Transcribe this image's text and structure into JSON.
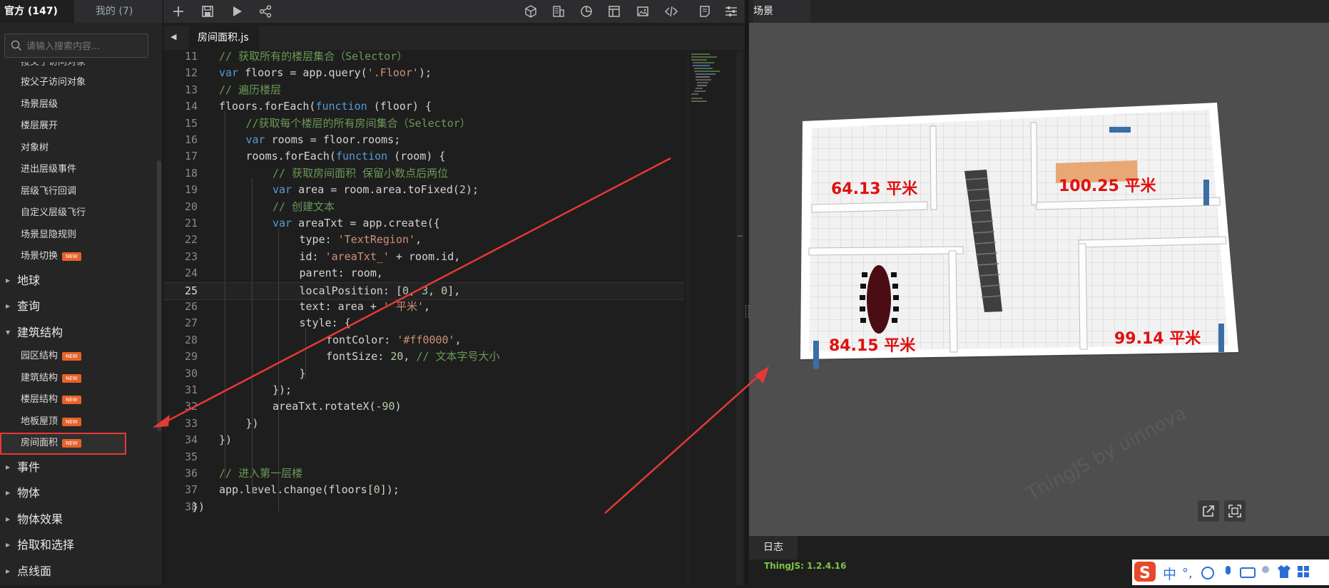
{
  "sidebar": {
    "tabs": [
      {
        "label": "官方 (147)"
      },
      {
        "label": "我的 (7)"
      }
    ],
    "search_placeholder": "请输入搜索内容...",
    "cut_item": "按父子访问对象",
    "items": [
      {
        "label": "按父子访问对象",
        "new": false
      },
      {
        "label": "场景层级",
        "new": false
      },
      {
        "label": "楼层展开",
        "new": false
      },
      {
        "label": "对象树",
        "new": false
      },
      {
        "label": "进出层级事件",
        "new": false
      },
      {
        "label": "层级飞行回调",
        "new": false
      },
      {
        "label": "自定义层级飞行",
        "new": false
      },
      {
        "label": "场景显隐规则",
        "new": false
      },
      {
        "label": "场景切换",
        "new": true
      }
    ],
    "categories": [
      {
        "label": "地球"
      },
      {
        "label": "查询"
      },
      {
        "label": "建筑结构"
      }
    ],
    "sub_items": [
      {
        "label": "园区结构",
        "new": true
      },
      {
        "label": "建筑结构",
        "new": true
      },
      {
        "label": "楼层结构",
        "new": true
      },
      {
        "label": "地板屋顶",
        "new": true
      },
      {
        "label": "房间面积",
        "new": true
      }
    ],
    "categories_after": [
      {
        "label": "事件"
      },
      {
        "label": "物体"
      },
      {
        "label": "物体效果"
      },
      {
        "label": "拾取和选择"
      },
      {
        "label": "点线面"
      }
    ],
    "badge_text": "NEW"
  },
  "editor": {
    "file_tab": "房间面积.js",
    "current_line": 25,
    "lines": [
      {
        "n": 11,
        "indent": 1,
        "html": "<span style=\"color:#6a9955\">// 获取所有的楼层集合（Selector）</span>"
      },
      {
        "n": 12,
        "indent": 1,
        "html": "<span style=\"color:#569cd6\">var</span> floors = app.query(<span style=\"color:#ce9178\">'.Floor'</span>);"
      },
      {
        "n": 13,
        "indent": 1,
        "html": "<span style=\"color:#6a9955\">// 遍历楼层</span>"
      },
      {
        "n": 14,
        "indent": 1,
        "html": "floors.forEach(<span style=\"color:#569cd6\">function</span> (floor) {"
      },
      {
        "n": 15,
        "indent": 2,
        "html": "<span style=\"color:#6a9955\">//获取每个楼层的所有房间集合（Selector）</span>"
      },
      {
        "n": 16,
        "indent": 2,
        "html": "<span style=\"color:#569cd6\">var</span> rooms = floor.rooms;"
      },
      {
        "n": 17,
        "indent": 2,
        "html": "rooms.forEach(<span style=\"color:#569cd6\">function</span> (room) {"
      },
      {
        "n": 18,
        "indent": 3,
        "html": "<span style=\"color:#6a9955\">// 获取房间面积 保留小数点后两位</span>"
      },
      {
        "n": 19,
        "indent": 3,
        "html": "<span style=\"color:#569cd6\">var</span> area = room.area.toFixed(<span style=\"color:#b5cea8\">2</span>);"
      },
      {
        "n": 20,
        "indent": 3,
        "html": "<span style=\"color:#6a9955\">// 创建文本</span>"
      },
      {
        "n": 21,
        "indent": 3,
        "html": "<span style=\"color:#569cd6\">var</span> areaTxt = app.create({"
      },
      {
        "n": 22,
        "indent": 4,
        "html": "type: <span style=\"color:#ce9178\">'TextRegion'</span>,"
      },
      {
        "n": 23,
        "indent": 4,
        "html": "id: <span style=\"color:#ce9178\">'areaTxt_'</span> + room.id,"
      },
      {
        "n": 24,
        "indent": 4,
        "html": "parent: room,"
      },
      {
        "n": 25,
        "indent": 4,
        "html": "localPosition: [<span style=\"color:#b5cea8\">0</span>, <span style=\"color:#b5cea8\">3</span>, <span style=\"color:#b5cea8\">0</span>],"
      },
      {
        "n": 26,
        "indent": 4,
        "html": "text: area + <span style=\"color:#ce9178\">' 平米'</span>,"
      },
      {
        "n": 27,
        "indent": 4,
        "html": "style: {"
      },
      {
        "n": 28,
        "indent": 5,
        "html": "fontColor: <span style=\"color:#ce9178\">'#ff0000'</span>,"
      },
      {
        "n": 29,
        "indent": 5,
        "html": "fontSize: <span style=\"color:#b5cea8\">20</span>, <span style=\"color:#6a9955\">// 文本字号大小</span>"
      },
      {
        "n": 30,
        "indent": 4,
        "html": "}"
      },
      {
        "n": 31,
        "indent": 3,
        "html": "});"
      },
      {
        "n": 32,
        "indent": 3,
        "html": "areaTxt.rotateX(<span style=\"color:#b5cea8\">-90</span>)"
      },
      {
        "n": 33,
        "indent": 2,
        "html": "})"
      },
      {
        "n": 34,
        "indent": 1,
        "html": "})"
      },
      {
        "n": 35,
        "indent": 0,
        "html": ""
      },
      {
        "n": 36,
        "indent": 1,
        "html": "<span style=\"color:#6a9955\">// 进入第一层楼</span>"
      },
      {
        "n": 37,
        "indent": 1,
        "html": "app.level.change(floors[<span style=\"color:#b5cea8\">0</span>]);"
      },
      {
        "n": 38,
        "indent": 0,
        "html": "})"
      }
    ]
  },
  "viewport": {
    "title": "场景",
    "room_labels": [
      "64.13 平米",
      "100.25 平米",
      "84.15 平米",
      "99.14 平米"
    ],
    "watermark": "ThingJS by uinnova",
    "label_color": "#e01010"
  },
  "log": {
    "tab": "日志",
    "line": "ThingJS: 1.2.4.16"
  },
  "ime": {
    "mode": "中"
  },
  "colors": {
    "highlight": "#e53935",
    "badge": "#e8622a",
    "log_text": "#7cc543"
  }
}
